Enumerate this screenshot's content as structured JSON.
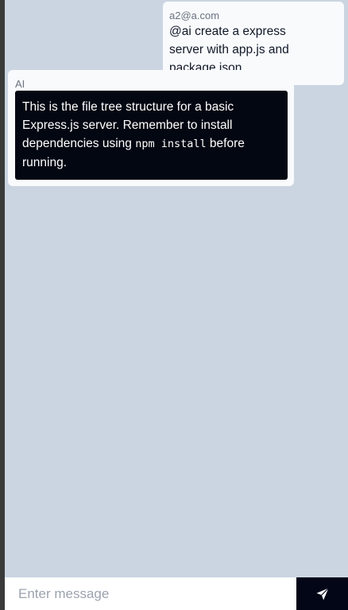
{
  "messages": [
    {
      "role": "user",
      "sender": "a2@a.com",
      "text": "@ai create a express server with app.js and package.json"
    },
    {
      "role": "ai",
      "sender": "AI",
      "text_before": "This is the file tree structure for a basic Express.js server. Remember to install dependencies using ",
      "code": "npm install",
      "text_after": " before running."
    }
  ],
  "composer": {
    "placeholder": "Enter message",
    "send_icon": "send-icon"
  },
  "colors": {
    "background": "#cbd5e1",
    "message_bg": "#f8fafc",
    "ai_bubble_bg": "#030712",
    "send_button_bg": "#020617"
  }
}
